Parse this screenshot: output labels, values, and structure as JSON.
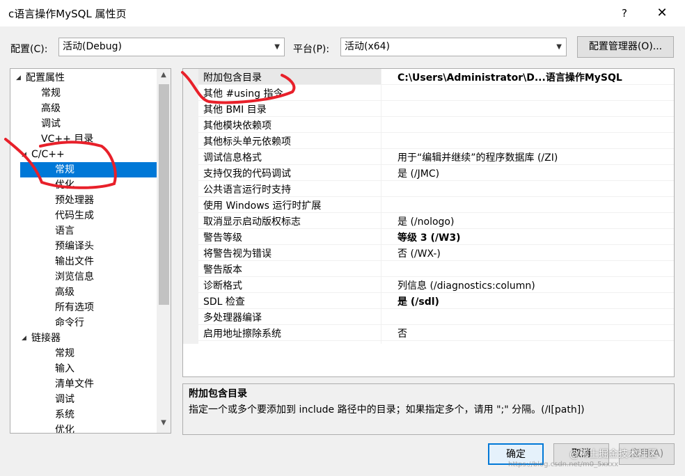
{
  "window": {
    "title": "c语言操作MySQL 属性页",
    "help": "?",
    "close": "✕"
  },
  "toolbar": {
    "config_label": "配置(C):",
    "config_value": "活动(Debug)",
    "platform_label": "平台(P):",
    "platform_value": "活动(x64)",
    "config_manager_button": "配置管理器(O)..."
  },
  "tree": {
    "items": [
      {
        "label": "配置属性",
        "expander": "◢"
      },
      {
        "label": "常规"
      },
      {
        "label": "高级"
      },
      {
        "label": "调试"
      },
      {
        "label": "VC++ 目录"
      },
      {
        "label": "C/C++",
        "expander": "◢"
      },
      {
        "label": "常规"
      },
      {
        "label": "优化"
      },
      {
        "label": "预处理器"
      },
      {
        "label": "代码生成"
      },
      {
        "label": "语言"
      },
      {
        "label": "预编译头"
      },
      {
        "label": "输出文件"
      },
      {
        "label": "浏览信息"
      },
      {
        "label": "高级"
      },
      {
        "label": "所有选项"
      },
      {
        "label": "命令行"
      },
      {
        "label": "链接器",
        "expander": "◢"
      },
      {
        "label": "常规"
      },
      {
        "label": "输入"
      },
      {
        "label": "清单文件"
      },
      {
        "label": "调试"
      },
      {
        "label": "系统"
      },
      {
        "label": "优化"
      }
    ],
    "scroll_up": "▲",
    "scroll_down": "▼"
  },
  "properties": [
    {
      "name": "附加包含目录",
      "value": "C:\\Users\\Administrator\\D...语言操作MySQL",
      "bold": true
    },
    {
      "name": "其他 #using 指令",
      "value": ""
    },
    {
      "name": "其他 BMI 目录",
      "value": ""
    },
    {
      "name": "其他模块依赖项",
      "value": ""
    },
    {
      "name": "其他标头单元依赖项",
      "value": ""
    },
    {
      "name": "调试信息格式",
      "value": "用于“编辑并继续”的程序数据库 (/ZI)"
    },
    {
      "name": "支持仅我的代码调试",
      "value": "是 (/JMC)"
    },
    {
      "name": "公共语言运行时支持",
      "value": ""
    },
    {
      "name": "使用 Windows 运行时扩展",
      "value": ""
    },
    {
      "name": "取消显示启动版权标志",
      "value": "是 (/nologo)"
    },
    {
      "name": "警告等级",
      "value": "等级 3 (/W3)",
      "bold": true
    },
    {
      "name": "将警告视为错误",
      "value": "否 (/WX-)"
    },
    {
      "name": "警告版本",
      "value": ""
    },
    {
      "name": "诊断格式",
      "value": "列信息 (/diagnostics:column)"
    },
    {
      "name": "SDL 检查",
      "value": "是 (/sdl)",
      "bold": true
    },
    {
      "name": "多处理器编译",
      "value": ""
    },
    {
      "name": "启用地址擦除系统",
      "value": "否"
    }
  ],
  "description": {
    "title": "附加包含目录",
    "text": "指定一个或多个要添加到 include 路径中的目录；如果指定多个，请用 \";\" 分隔。(/I[path])"
  },
  "buttons": {
    "ok": "确定",
    "cancel": "取消",
    "apply": "应用(A)"
  },
  "watermark": {
    "text": "@稀土掘金技术社区",
    "url": "https://blog.csdn.net/m0_5xxxx"
  },
  "annotation_color": "#e8202a",
  "selection_color": "#0078d7"
}
